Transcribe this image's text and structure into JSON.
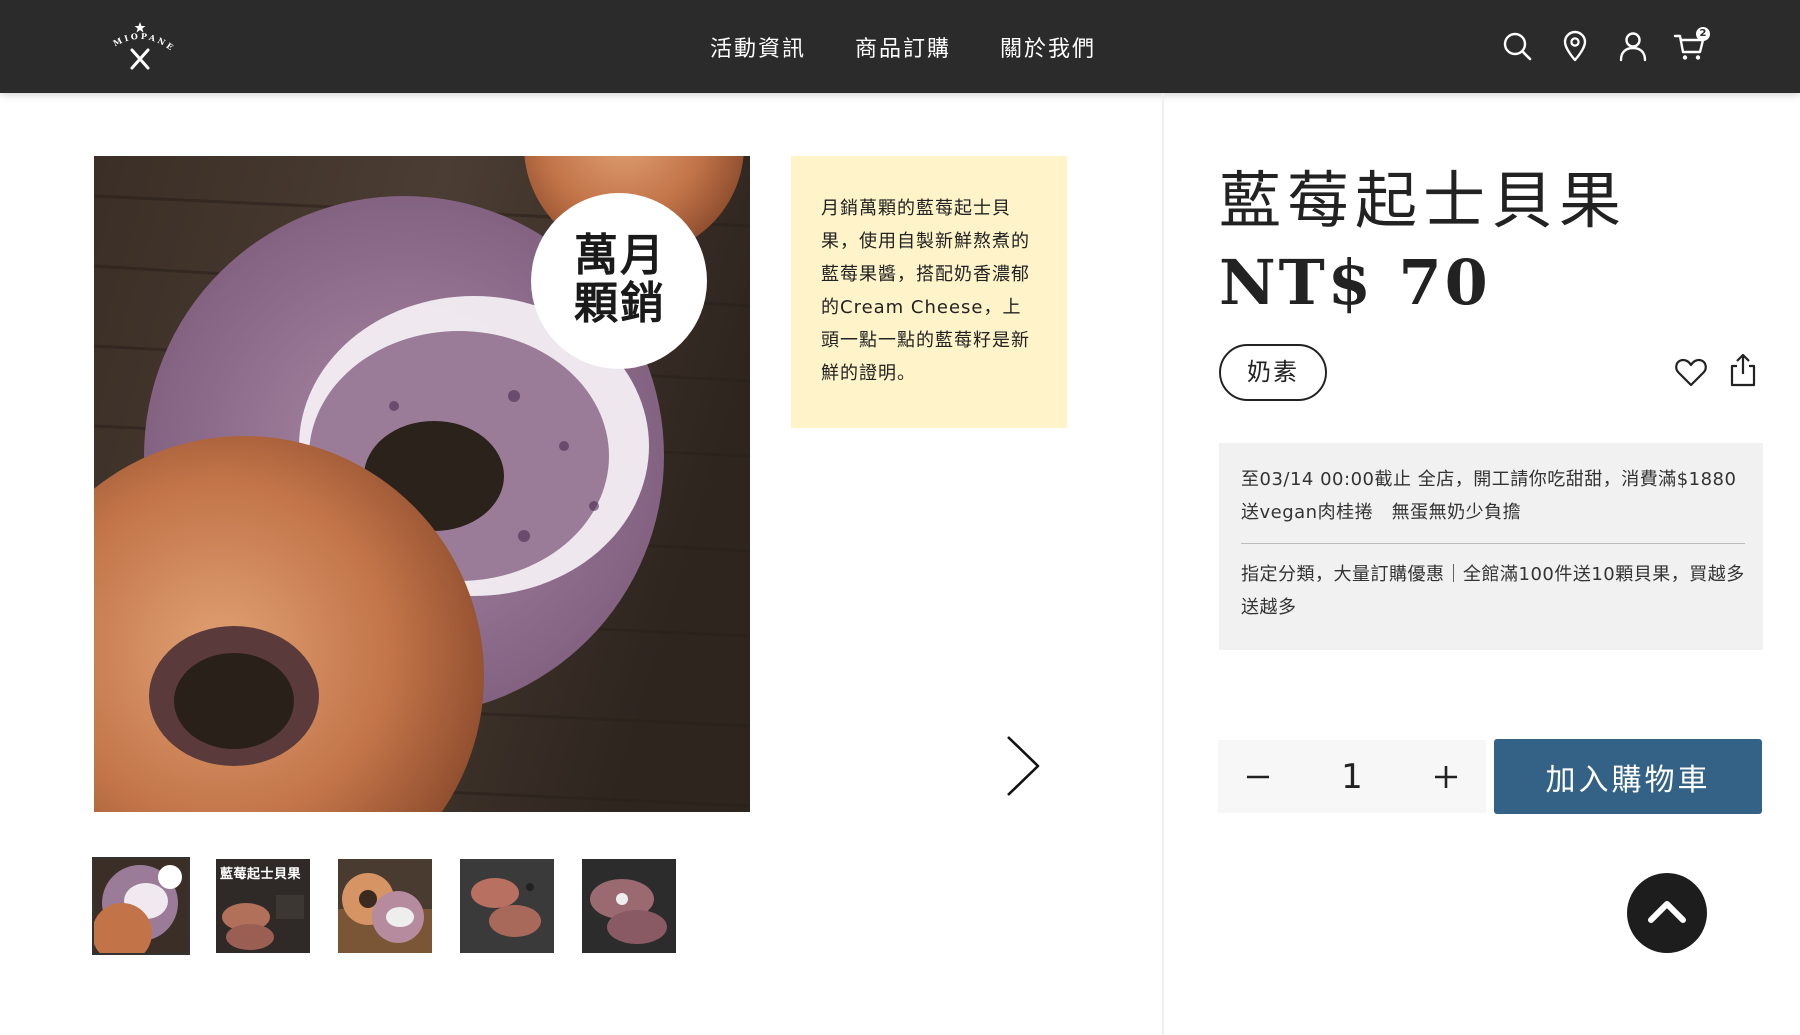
{
  "header": {
    "logo_text": "MIOPANE",
    "nav": [
      "活動資訊",
      "商品訂購",
      "關於我們"
    ],
    "icons": [
      "search-icon",
      "location-pin-icon",
      "user-icon",
      "cart-icon"
    ],
    "cart_count": "2",
    "background_color": "#2b2b2b"
  },
  "gallery": {
    "badge_text": "萬月\n顆銷",
    "badge_line1": "萬月",
    "badge_line2": "顆銷",
    "thumbnails": [
      {
        "caption": ""
      },
      {
        "caption": "藍莓起士貝果"
      },
      {
        "caption": ""
      },
      {
        "caption": ""
      },
      {
        "caption": ""
      }
    ],
    "next_icon": "chevron-right-icon"
  },
  "description": {
    "text": "月銷萬顆的藍莓起士貝果，使用自製新鮮熬煮的藍莓果醬，搭配奶香濃郁的Cream Cheese，上頭一點一點的藍莓籽是新鮮的證明。",
    "background_color": "#fff4c9"
  },
  "product": {
    "title": "藍莓起士貝果",
    "price": "NT$ 70",
    "tag": "奶素",
    "icons": [
      "heart-icon",
      "share-icon"
    ]
  },
  "promotions": [
    "至03/14 00:00截止 全店，開工請你吃甜甜，消費滿$1880送vegan肉桂捲　無蛋無奶少負擔",
    "指定分類，大量訂購優惠｜全館滿100件送10顆貝果，買越多送越多"
  ],
  "purchase": {
    "quantity": "1",
    "add_to_cart_label": "加入購物車",
    "button_color": "#346286"
  },
  "back_to_top_icon": "chevron-up-icon"
}
